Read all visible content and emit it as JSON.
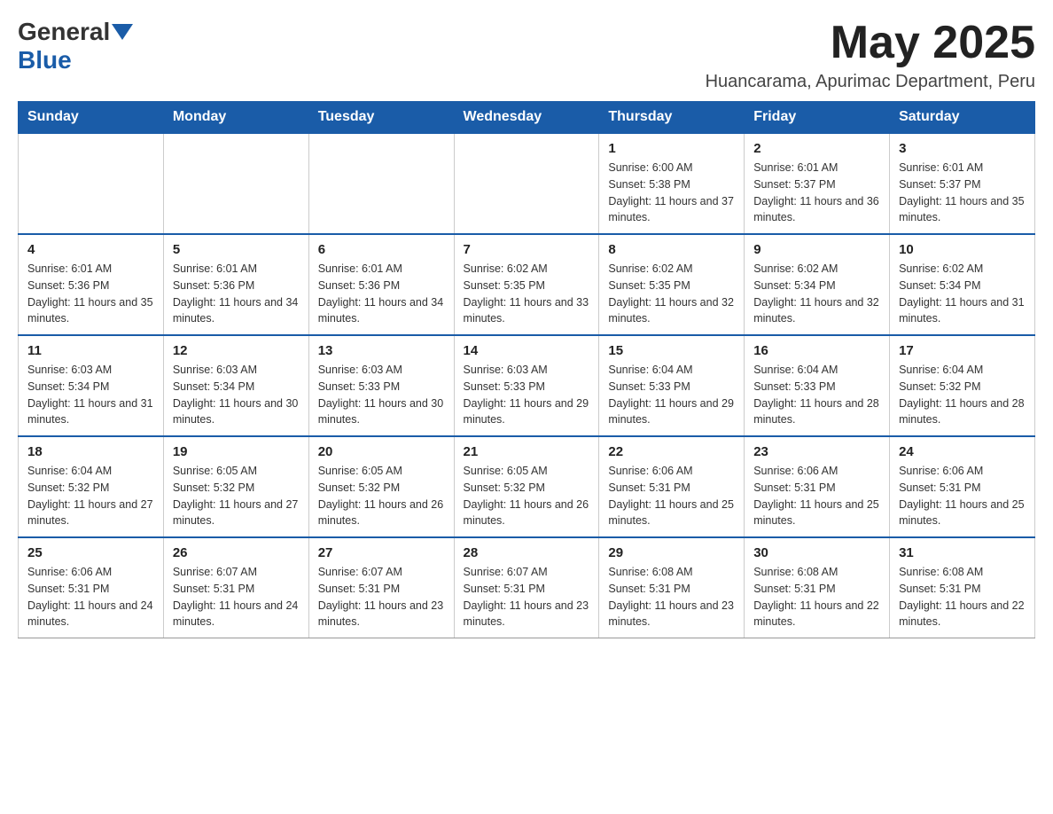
{
  "logo": {
    "general": "General",
    "blue": "Blue"
  },
  "title": "May 2025",
  "location": "Huancarama, Apurimac Department, Peru",
  "days_of_week": [
    "Sunday",
    "Monday",
    "Tuesday",
    "Wednesday",
    "Thursday",
    "Friday",
    "Saturday"
  ],
  "weeks": [
    [
      {
        "day": "",
        "info": ""
      },
      {
        "day": "",
        "info": ""
      },
      {
        "day": "",
        "info": ""
      },
      {
        "day": "",
        "info": ""
      },
      {
        "day": "1",
        "info": "Sunrise: 6:00 AM\nSunset: 5:38 PM\nDaylight: 11 hours and 37 minutes."
      },
      {
        "day": "2",
        "info": "Sunrise: 6:01 AM\nSunset: 5:37 PM\nDaylight: 11 hours and 36 minutes."
      },
      {
        "day": "3",
        "info": "Sunrise: 6:01 AM\nSunset: 5:37 PM\nDaylight: 11 hours and 35 minutes."
      }
    ],
    [
      {
        "day": "4",
        "info": "Sunrise: 6:01 AM\nSunset: 5:36 PM\nDaylight: 11 hours and 35 minutes."
      },
      {
        "day": "5",
        "info": "Sunrise: 6:01 AM\nSunset: 5:36 PM\nDaylight: 11 hours and 34 minutes."
      },
      {
        "day": "6",
        "info": "Sunrise: 6:01 AM\nSunset: 5:36 PM\nDaylight: 11 hours and 34 minutes."
      },
      {
        "day": "7",
        "info": "Sunrise: 6:02 AM\nSunset: 5:35 PM\nDaylight: 11 hours and 33 minutes."
      },
      {
        "day": "8",
        "info": "Sunrise: 6:02 AM\nSunset: 5:35 PM\nDaylight: 11 hours and 32 minutes."
      },
      {
        "day": "9",
        "info": "Sunrise: 6:02 AM\nSunset: 5:34 PM\nDaylight: 11 hours and 32 minutes."
      },
      {
        "day": "10",
        "info": "Sunrise: 6:02 AM\nSunset: 5:34 PM\nDaylight: 11 hours and 31 minutes."
      }
    ],
    [
      {
        "day": "11",
        "info": "Sunrise: 6:03 AM\nSunset: 5:34 PM\nDaylight: 11 hours and 31 minutes."
      },
      {
        "day": "12",
        "info": "Sunrise: 6:03 AM\nSunset: 5:34 PM\nDaylight: 11 hours and 30 minutes."
      },
      {
        "day": "13",
        "info": "Sunrise: 6:03 AM\nSunset: 5:33 PM\nDaylight: 11 hours and 30 minutes."
      },
      {
        "day": "14",
        "info": "Sunrise: 6:03 AM\nSunset: 5:33 PM\nDaylight: 11 hours and 29 minutes."
      },
      {
        "day": "15",
        "info": "Sunrise: 6:04 AM\nSunset: 5:33 PM\nDaylight: 11 hours and 29 minutes."
      },
      {
        "day": "16",
        "info": "Sunrise: 6:04 AM\nSunset: 5:33 PM\nDaylight: 11 hours and 28 minutes."
      },
      {
        "day": "17",
        "info": "Sunrise: 6:04 AM\nSunset: 5:32 PM\nDaylight: 11 hours and 28 minutes."
      }
    ],
    [
      {
        "day": "18",
        "info": "Sunrise: 6:04 AM\nSunset: 5:32 PM\nDaylight: 11 hours and 27 minutes."
      },
      {
        "day": "19",
        "info": "Sunrise: 6:05 AM\nSunset: 5:32 PM\nDaylight: 11 hours and 27 minutes."
      },
      {
        "day": "20",
        "info": "Sunrise: 6:05 AM\nSunset: 5:32 PM\nDaylight: 11 hours and 26 minutes."
      },
      {
        "day": "21",
        "info": "Sunrise: 6:05 AM\nSunset: 5:32 PM\nDaylight: 11 hours and 26 minutes."
      },
      {
        "day": "22",
        "info": "Sunrise: 6:06 AM\nSunset: 5:31 PM\nDaylight: 11 hours and 25 minutes."
      },
      {
        "day": "23",
        "info": "Sunrise: 6:06 AM\nSunset: 5:31 PM\nDaylight: 11 hours and 25 minutes."
      },
      {
        "day": "24",
        "info": "Sunrise: 6:06 AM\nSunset: 5:31 PM\nDaylight: 11 hours and 25 minutes."
      }
    ],
    [
      {
        "day": "25",
        "info": "Sunrise: 6:06 AM\nSunset: 5:31 PM\nDaylight: 11 hours and 24 minutes."
      },
      {
        "day": "26",
        "info": "Sunrise: 6:07 AM\nSunset: 5:31 PM\nDaylight: 11 hours and 24 minutes."
      },
      {
        "day": "27",
        "info": "Sunrise: 6:07 AM\nSunset: 5:31 PM\nDaylight: 11 hours and 23 minutes."
      },
      {
        "day": "28",
        "info": "Sunrise: 6:07 AM\nSunset: 5:31 PM\nDaylight: 11 hours and 23 minutes."
      },
      {
        "day": "29",
        "info": "Sunrise: 6:08 AM\nSunset: 5:31 PM\nDaylight: 11 hours and 23 minutes."
      },
      {
        "day": "30",
        "info": "Sunrise: 6:08 AM\nSunset: 5:31 PM\nDaylight: 11 hours and 22 minutes."
      },
      {
        "day": "31",
        "info": "Sunrise: 6:08 AM\nSunset: 5:31 PM\nDaylight: 11 hours and 22 minutes."
      }
    ]
  ]
}
